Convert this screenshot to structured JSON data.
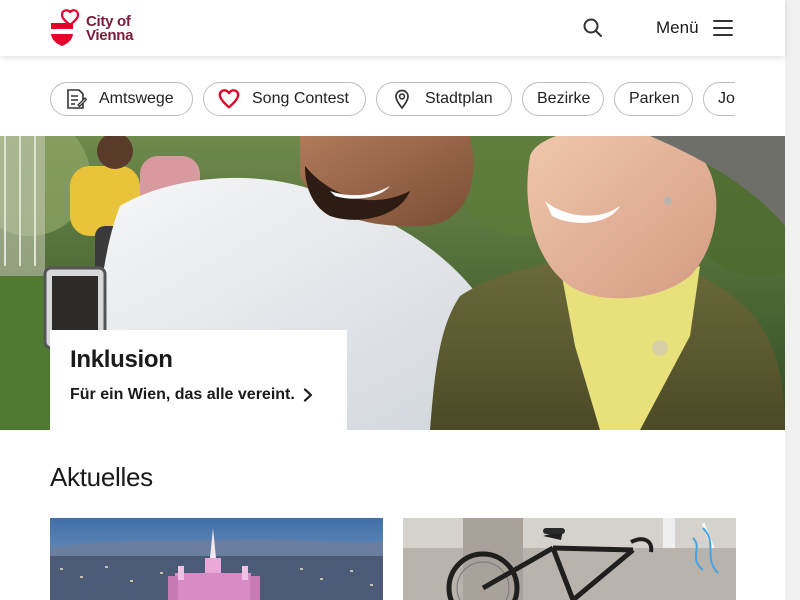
{
  "header": {
    "logo_line1": "City of",
    "logo_line2": "Vienna",
    "menu_label": "Menü",
    "search_icon": "search-icon",
    "menu_icon": "hamburger-icon"
  },
  "chips": [
    {
      "label": "Amtswege",
      "icon": "form-icon"
    },
    {
      "label": "Song Contest",
      "icon": "heart-icon"
    },
    {
      "label": "Stadtplan",
      "icon": "map-pin-icon"
    },
    {
      "label": "Bezirke",
      "icon": ""
    },
    {
      "label": "Parken",
      "icon": ""
    },
    {
      "label": "Jo",
      "icon": ""
    }
  ],
  "hero": {
    "title": "Inklusion",
    "link_text": "Für ein Wien, das alle vereint."
  },
  "aktuelles": {
    "title": "Aktuelles"
  },
  "colors": {
    "brand_red": "#e4002b",
    "brand_wine": "#7a1c3c"
  }
}
